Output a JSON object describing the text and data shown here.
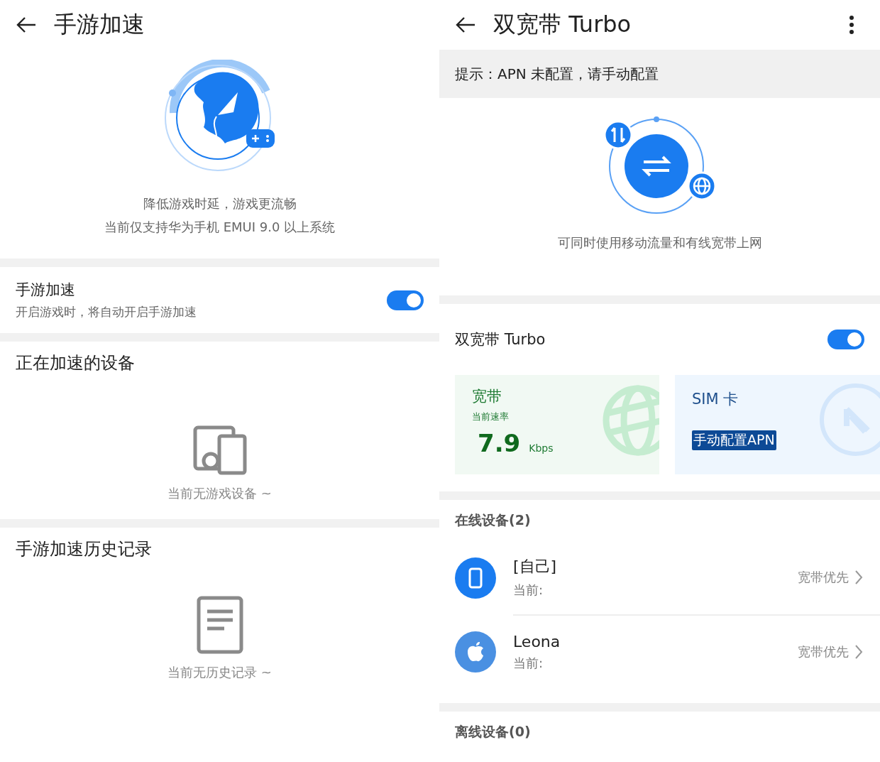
{
  "left": {
    "title": "手游加速",
    "description": [
      "降低游戏时延，游戏更流畅",
      "当前仅支持华为手机 EMUI 9.0 以上系统"
    ],
    "setting": {
      "label": "手游加速",
      "subtitle": "开启游戏时，将自动开启手游加速",
      "on": true
    },
    "sections": [
      {
        "kind": "devices",
        "title": "正在加速的设备",
        "empty_text": "当前无游戏设备 ~"
      },
      {
        "kind": "history",
        "title": "手游加速历史记录",
        "empty_text": "当前无历史记录 ~"
      }
    ]
  },
  "right": {
    "title": "双宽带 Turbo",
    "notice": "提示：APN 未配置，请手动配置",
    "caption": "可同时使用移动流量和有线宽带上网",
    "setting": {
      "label": "双宽带 Turbo",
      "on": true
    },
    "cards": [
      {
        "kind": "broadband",
        "title": "宽带",
        "subtitle": "当前速率",
        "value": "7.9",
        "unit": "Kbps"
      },
      {
        "kind": "sim",
        "title": "SIM 卡",
        "action": "手动配置APN"
      }
    ],
    "online_title": "在线设备(2)",
    "devices": [
      {
        "kind": "phone",
        "name": "[自己]",
        "status": "当前:",
        "priority": "宽带优先"
      },
      {
        "kind": "apple",
        "name": "Leona",
        "status": "当前:",
        "priority": "宽带优先"
      }
    ],
    "offline_title": "离线设备(0)"
  }
}
